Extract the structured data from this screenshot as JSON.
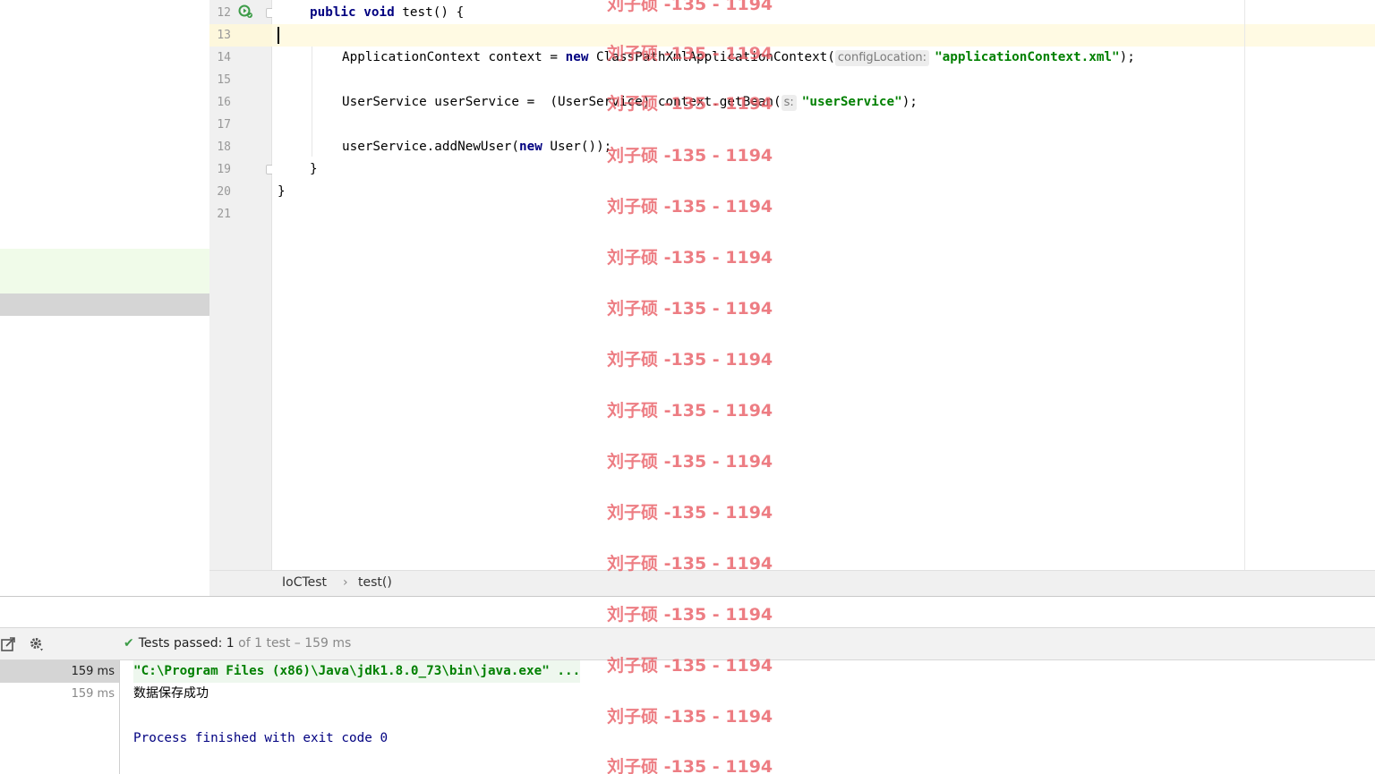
{
  "editor": {
    "line_numbers": [
      "12",
      "13",
      "14",
      "15",
      "16",
      "17",
      "18",
      "19",
      "20",
      "21"
    ],
    "lines": {
      "l12_kw1": "public",
      "l12_kw2": "void",
      "l12_rest": " test() {",
      "l14_pre": "ApplicationContext context = ",
      "l14_kw": "new",
      "l14_mid": " ClassPathXmlApplicationContext(",
      "l14_hint": "configLocation:",
      "l14_str": "\"applicationContext.xml\"",
      "l14_end": ");",
      "l16_pre": "UserService userService =  (UserService) context.getBean(",
      "l16_hint": "s:",
      "l16_str": "\"userService\"",
      "l16_end": ");",
      "l18_pre": "userService.addNewUser(",
      "l18_kw": "new",
      "l18_end": " User());",
      "l19": "}",
      "l20": "}"
    }
  },
  "breadcrumb": {
    "items": [
      "IoCTest",
      "test()"
    ],
    "separator": "›"
  },
  "run_panel": {
    "status_label": "Tests passed:",
    "passed_count": "1",
    "status_rest": "of 1 test – 159 ms",
    "tree_rows": [
      "159 ms",
      "159 ms"
    ],
    "console": {
      "cmd": "\"C:\\Program Files (x86)\\Java\\jdk1.8.0_73\\bin\\java.exe\" ...",
      "output": "数据保存成功",
      "exit": "Process finished with exit code 0"
    }
  },
  "watermark": {
    "text": "刘子硕 -135 - 1194"
  },
  "colors": {
    "keyword": "#000080",
    "string": "#008000",
    "watermark": "#e85860",
    "pass": "#3d9c48"
  }
}
